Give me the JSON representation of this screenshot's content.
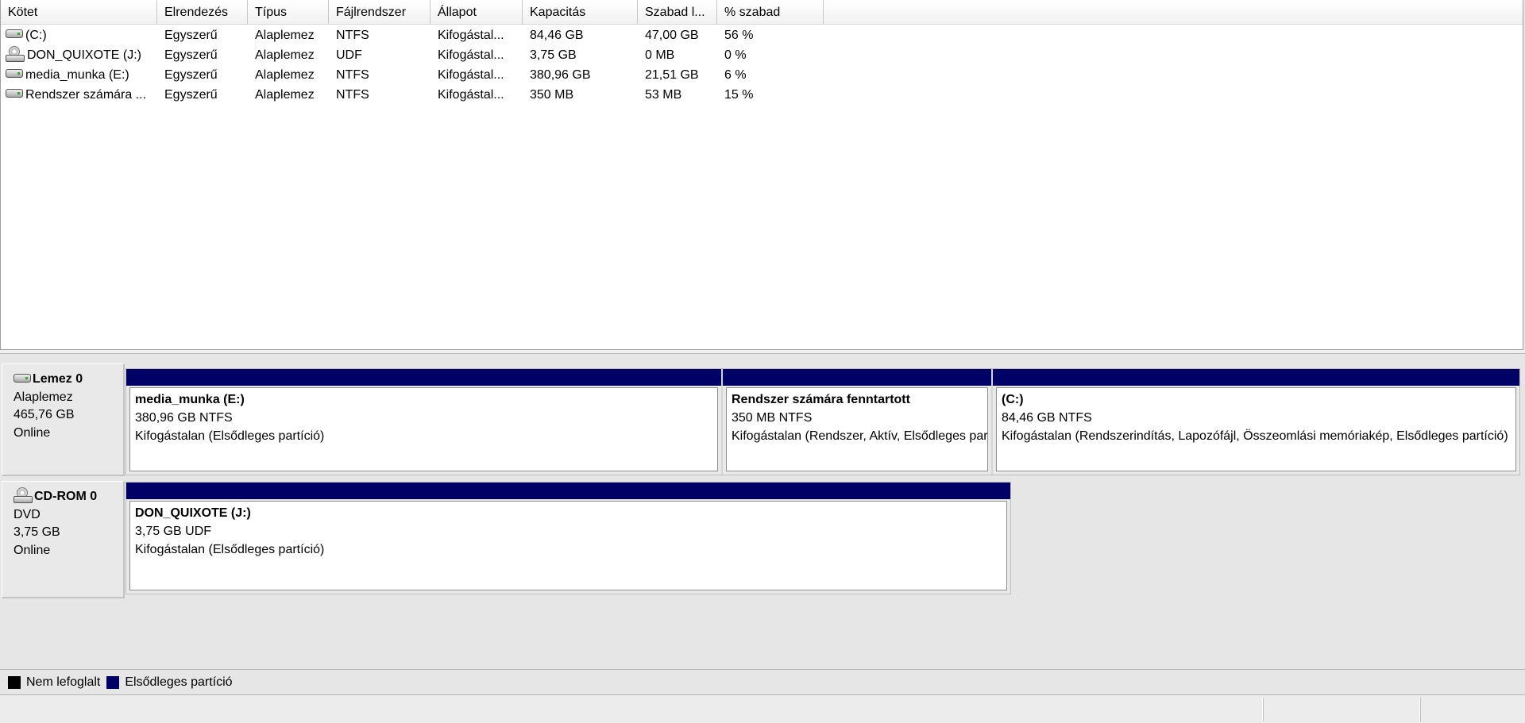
{
  "columns": [
    "Kötet",
    "Elrendezés",
    "Típus",
    "Fájlrendszer",
    "Állapot",
    "Kapacitás",
    "Szabad l...",
    "% szabad"
  ],
  "volumes": [
    {
      "icon": "hard-drive-icon",
      "name": "(C:)",
      "layout": "Egyszerű",
      "type": "Alaplemez",
      "fs": "NTFS",
      "status": "Kifogástal...",
      "capacity": "84,46 GB",
      "free": "47,00 GB",
      "pct": "56 %"
    },
    {
      "icon": "cd-drive-icon",
      "name": "DON_QUIXOTE (J:)",
      "layout": "Egyszerű",
      "type": "Alaplemez",
      "fs": "UDF",
      "status": "Kifogástal...",
      "capacity": "3,75 GB",
      "free": "0 MB",
      "pct": "0 %"
    },
    {
      "icon": "hard-drive-icon",
      "name": "media_munka (E:)",
      "layout": "Egyszerű",
      "type": "Alaplemez",
      "fs": "NTFS",
      "status": "Kifogástal...",
      "capacity": "380,96 GB",
      "free": "21,51 GB",
      "pct": "6 %"
    },
    {
      "icon": "hard-drive-icon",
      "name": "Rendszer számára ...",
      "layout": "Egyszerű",
      "type": "Alaplemez",
      "fs": "NTFS",
      "status": "Kifogástal...",
      "capacity": "350 MB",
      "free": "53 MB",
      "pct": "15 %"
    }
  ],
  "disks": [
    {
      "icon": "hard-drive-icon",
      "title": "Lemez 0",
      "type": "Alaplemez",
      "size": "465,76 GB",
      "state": "Online",
      "partitions": [
        {
          "name": "media_munka  (E:)",
          "size_fs": "380,96 GB NTFS",
          "status": "Kifogástalan (Elsődleges partíció)"
        },
        {
          "name": "Rendszer számára fenntartott",
          "size_fs": "350 MB NTFS",
          "status": "Kifogástalan (Rendszer, Aktív, Elsődleges partíció)"
        },
        {
          "name": " (C:)",
          "size_fs": "84,46 GB NTFS",
          "status": "Kifogástalan (Rendszerindítás, Lapozófájl, Összeomlási memóriakép, Elsődleges partíció)"
        }
      ]
    },
    {
      "icon": "cd-drive-icon",
      "title": "CD-ROM 0",
      "type": "DVD",
      "size": "3,75 GB",
      "state": "Online",
      "partitions": [
        {
          "name": "DON_QUIXOTE  (J:)",
          "size_fs": "3,75 GB UDF",
          "status": "Kifogástalan (Elsődleges partíció)"
        }
      ]
    }
  ],
  "legend": [
    {
      "label": "Nem lefoglalt",
      "color": "#000000"
    },
    {
      "label": "Elsődleges partíció",
      "color": "#000066"
    }
  ],
  "colors": {
    "partition_header": "#000066",
    "unallocated": "#000000"
  }
}
